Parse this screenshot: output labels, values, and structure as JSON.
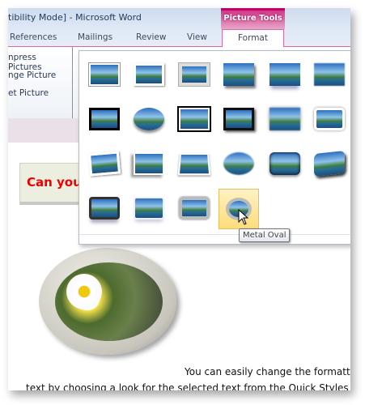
{
  "window": {
    "title": "tibility Mode]  -  Microsoft Word",
    "contextual_tab": "Picture Tools"
  },
  "tabs": [
    "References",
    "Mailings",
    "Review",
    "View",
    "Format"
  ],
  "ribbon": {
    "items": [
      "npress Pictures",
      "nge Picture",
      "et Picture"
    ]
  },
  "gallery": {
    "style_count": 22,
    "hovered_index": 21,
    "tooltip": "Metal Oval",
    "hover_color": "#fddc7a"
  },
  "document": {
    "heading": "Can you",
    "heading_color": "#ee0000",
    "lines": [
      "You can easily change the formatti",
      "text by choosing a look for the selected text from the Quick Styles g"
    ]
  }
}
